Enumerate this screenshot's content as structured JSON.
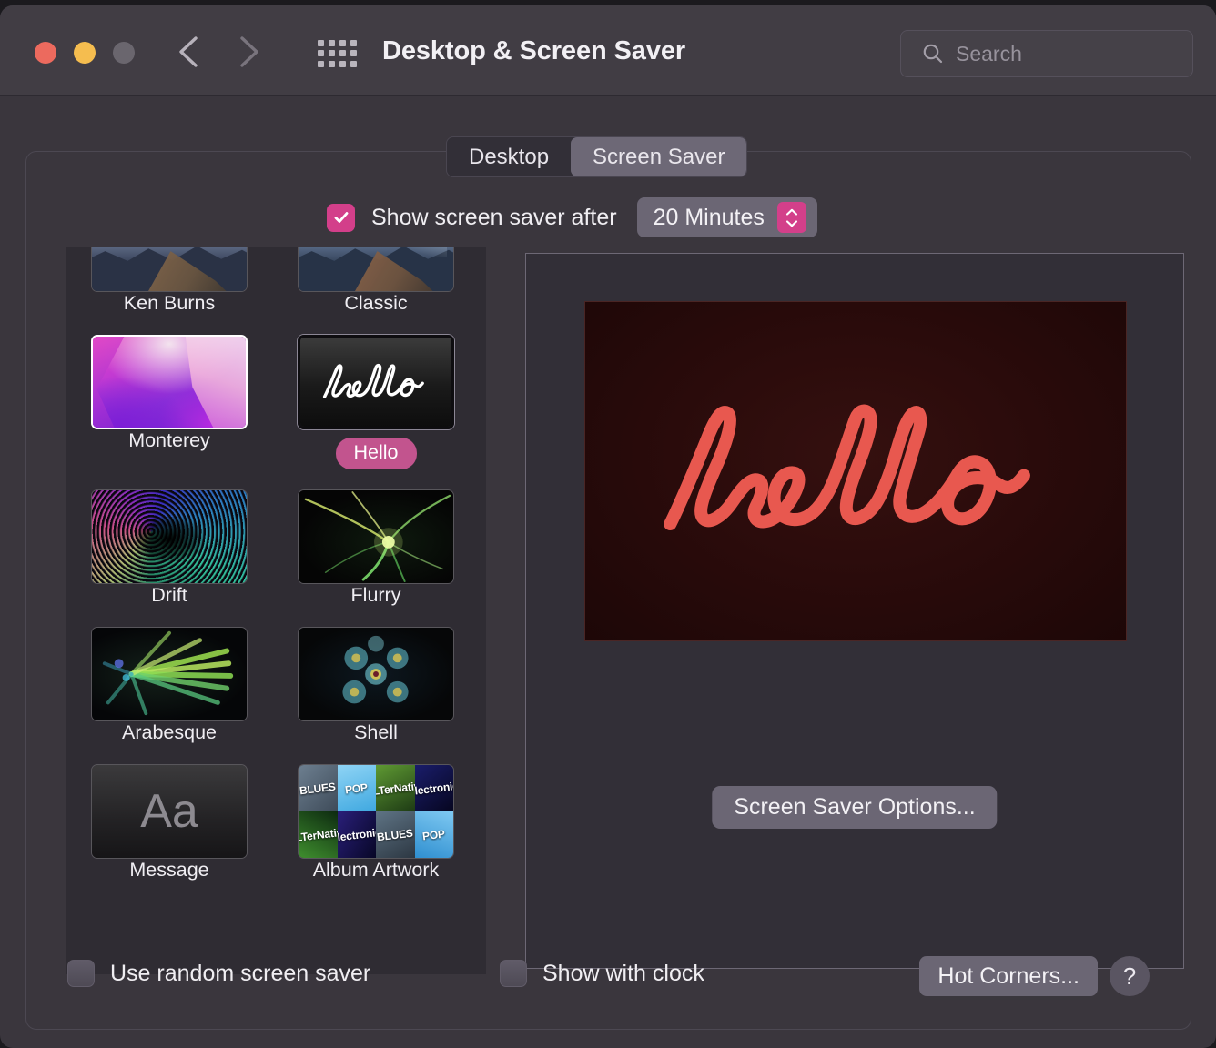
{
  "window": {
    "title": "Desktop & Screen Saver",
    "traffic_lights": [
      "close",
      "minimize",
      "zoom"
    ],
    "nav": {
      "back": "back-arrow",
      "forward": "forward-arrow",
      "grid": "show-all-grid"
    },
    "search": {
      "placeholder": "Search",
      "value": "",
      "icon": "search-icon"
    }
  },
  "tabs": [
    {
      "label": "Desktop",
      "active": false
    },
    {
      "label": "Screen Saver",
      "active": true
    }
  ],
  "show_after": {
    "checkbox_checked": true,
    "label": "Show screen saver after",
    "value": "20 Minutes",
    "stepper_icon": "stepper-updown-icon"
  },
  "screensavers": [
    {
      "name": "Ken Burns",
      "art": "mountain",
      "selected": false,
      "badge": false
    },
    {
      "name": "Classic",
      "art": "classic",
      "selected": false,
      "badge": false
    },
    {
      "name": "Monterey",
      "art": "monterey",
      "selected": false,
      "badge": false
    },
    {
      "name": "Hello",
      "art": "hello",
      "selected": true,
      "badge": true
    },
    {
      "name": "Drift",
      "art": "drift",
      "selected": false,
      "badge": false
    },
    {
      "name": "Flurry",
      "art": "flurry",
      "selected": false,
      "badge": false
    },
    {
      "name": "Arabesque",
      "art": "arabesque",
      "selected": false,
      "badge": false
    },
    {
      "name": "Shell",
      "art": "shell",
      "selected": false,
      "badge": false
    },
    {
      "name": "Message",
      "art": "message",
      "selected": false,
      "badge": false
    },
    {
      "name": "Album Artwork",
      "art": "album",
      "selected": false,
      "badge": false
    }
  ],
  "message_thumb_text": "Aa",
  "album_tiles": [
    "BLUES",
    "POP",
    "ALTerNative",
    "electronic",
    "ALTerNative",
    "electronic",
    "BLUES",
    "POP"
  ],
  "preview": {
    "screensaver": "Hello",
    "word": "hello",
    "background": "#2a0b0b",
    "stroke_color": "#e8584f"
  },
  "buttons": {
    "screen_saver_options": "Screen Saver Options...",
    "hot_corners": "Hot Corners...",
    "help": "?"
  },
  "footer": {
    "use_random": {
      "label": "Use random screen saver",
      "checked": false
    },
    "show_with_clock": {
      "label": "Show with clock",
      "checked": false
    }
  },
  "colors": {
    "accent": "#d33f8a",
    "badge": "#c2548e",
    "window_bg": "#3a363d",
    "titlebar_bg": "#413d44",
    "list_bg": "#2f2c33",
    "button_bg": "#6b6674"
  }
}
